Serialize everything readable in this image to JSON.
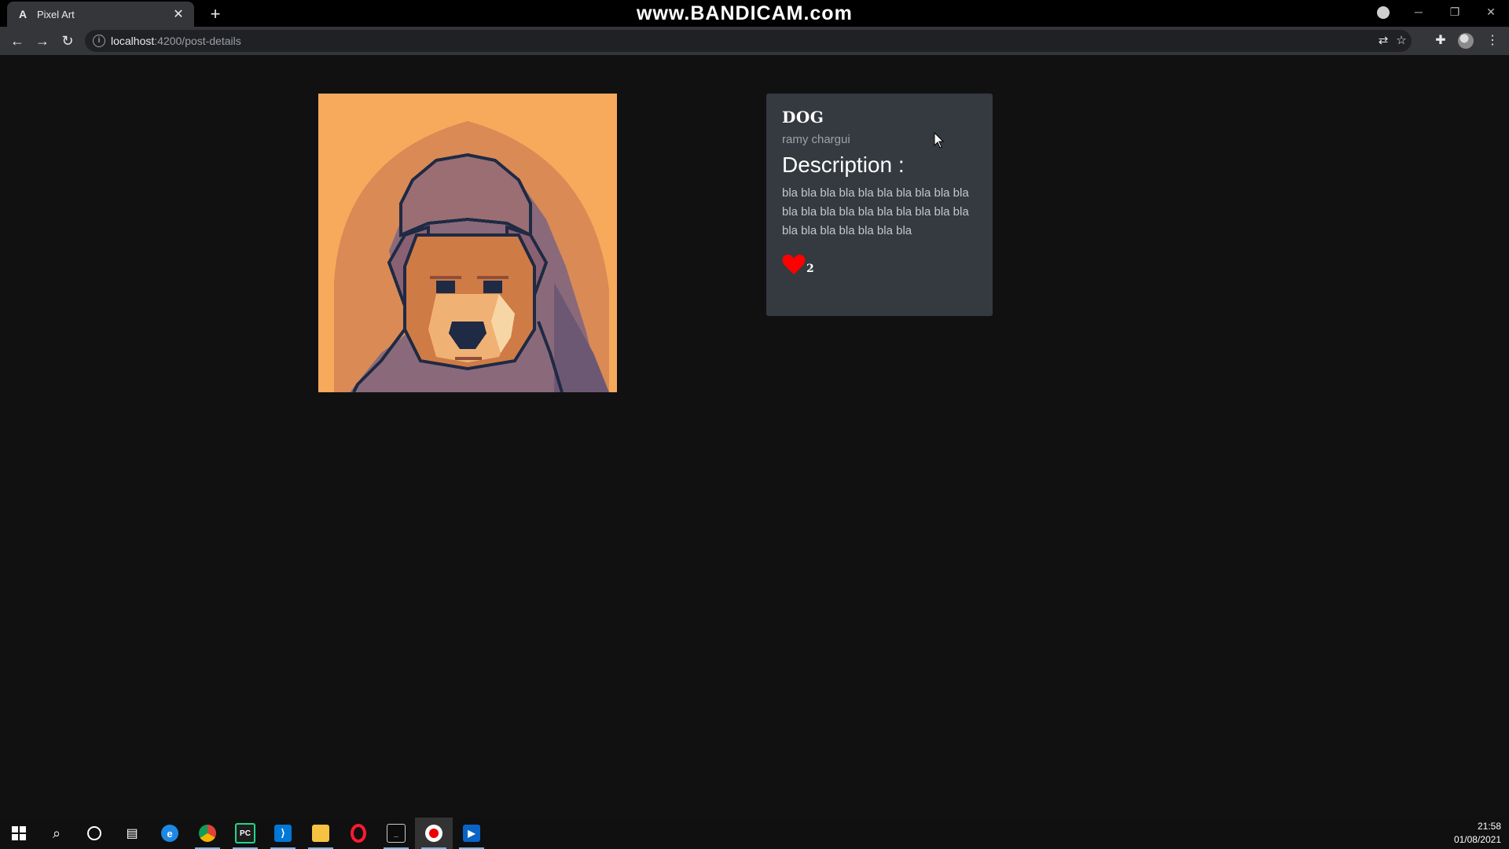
{
  "browser": {
    "tab_title": "Pixel Art",
    "tab_favicon": "A",
    "url_host": "localhost",
    "url_path": ":4200/post-details",
    "watermark": "www.BANDICAM.com"
  },
  "post": {
    "title": "DOG",
    "author": "ramy chargui",
    "description_heading": "Description :",
    "description": "bla bla bla bla bla bla bla bla bla bla bla bla bla bla bla bla bla bla bla bla bla bla bla bla bla bla bla",
    "likes": "2"
  },
  "taskbar": {
    "time": "21:58",
    "date": "01/08/2021"
  },
  "colors": {
    "page_bg": "#111111",
    "card_bg": "#353a40",
    "heart": "#ff0000",
    "image_bg": "#f7a95c"
  }
}
